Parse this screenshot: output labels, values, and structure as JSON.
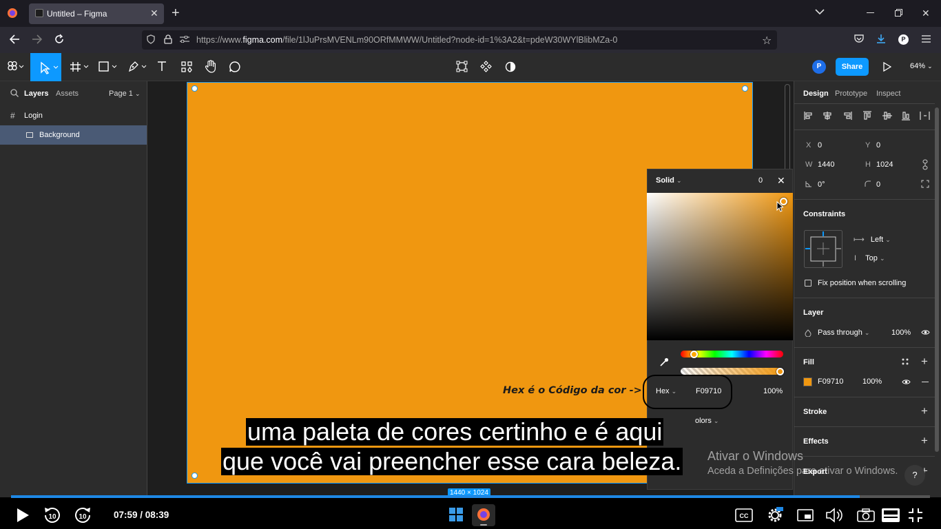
{
  "browser": {
    "tab_title": "Untitled – Figma",
    "url_prefix": "https://www.",
    "url_domain": "figma.com",
    "url_path": "/file/1lJuPrsMVENLm90ORfMMWW/Untitled?node-id=1%3A2&t=pdeW30WYlBlibMZa-0",
    "profile_initial": "P"
  },
  "toolbar": {
    "share_label": "Share",
    "avatar_initial": "P",
    "zoom": "64%"
  },
  "left_panel": {
    "tabs": [
      "Layers",
      "Assets"
    ],
    "page_label": "Page 1",
    "layers": [
      {
        "name": "Login",
        "icon": "frame-icon"
      },
      {
        "name": "Background",
        "icon": "rectangle-icon"
      }
    ]
  },
  "canvas": {
    "frame_color": "#F09710",
    "size_badge": "1440 × 1024"
  },
  "picker": {
    "mode": "Solid",
    "format": "Hex",
    "hex": "F09710",
    "opacity": "100%",
    "colors_partial": "olors",
    "top_value": "0"
  },
  "annotation": "Hex é o Código da cor ->",
  "subtitles": [
    "uma paleta de cores certinho e é aqui",
    "que você vai preencher esse cara beleza."
  ],
  "right_panel": {
    "tabs": [
      "Design",
      "Prototype",
      "Inspect"
    ],
    "x_label": "X",
    "x": "0",
    "y_label": "Y",
    "y": "0",
    "w_label": "W",
    "w": "1440",
    "h_label": "H",
    "h": "1024",
    "rotation": "0°",
    "radius": "0",
    "constraints_title": "Constraints",
    "constraint_h": "Left",
    "constraint_v": "Top",
    "fix_position": "Fix position when scrolling",
    "layer_title": "Layer",
    "blend": "Pass through",
    "layer_opacity": "100%",
    "fill_title": "Fill",
    "fill_hex": "F09710",
    "fill_opacity": "100%",
    "stroke_title": "Stroke",
    "effects_title": "Effects",
    "export_title": "Export",
    "help": "?"
  },
  "watermark": {
    "line1": "Ativar o Windows",
    "line2": "Aceda a Definições para ativar o Windows."
  },
  "player": {
    "time": "07:59 / 08:39",
    "progress": 0.9234
  }
}
